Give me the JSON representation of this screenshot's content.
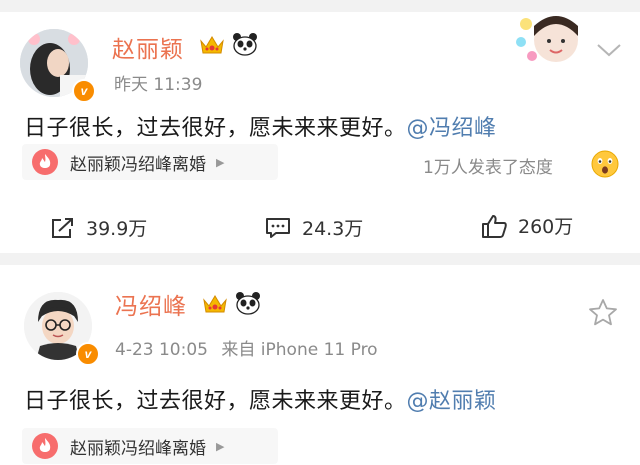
{
  "posts": [
    {
      "name": "赵丽颖",
      "time": "昨天 11:39",
      "text": "日子很长，过去很好，愿未来来更好。",
      "mention": "@冯绍峰",
      "topic": "赵丽颖冯绍峰离婚",
      "reaction_text": "1万人发表了态度",
      "stats": {
        "repost": "39.9万",
        "comment": "24.3万",
        "like": "260万"
      }
    },
    {
      "name": "冯绍峰",
      "time": "4-23 10:05",
      "source": "来自 iPhone 11 Pro",
      "text": "日子很长，过去很好，愿未来来更好。",
      "mention": "@赵丽颖",
      "topic": "赵丽颖冯绍峰离婚"
    }
  ],
  "badges": {
    "verified": "v"
  },
  "colors": {
    "name": "#eb7350",
    "mention": "#507daf",
    "meta": "#8a8a8a",
    "verified": "#f98c00"
  },
  "icons": [
    "crown-icon",
    "panda-icon",
    "chevron-down-icon",
    "flame-icon",
    "surprised-emoji-icon",
    "share-icon",
    "comment-icon",
    "like-icon",
    "star-icon"
  ]
}
